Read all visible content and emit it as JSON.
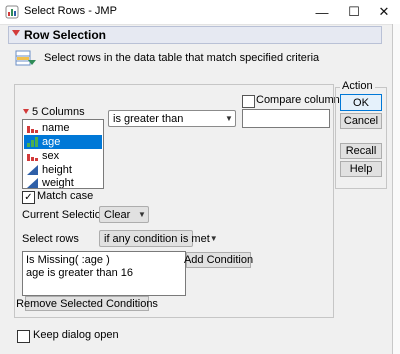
{
  "window": {
    "title": "Select Rows - JMP",
    "minimize_glyph": "—",
    "maximize_glyph": "☐",
    "close_glyph": "✕",
    "app_icon": "jmp-app-icon"
  },
  "outline": {
    "title": "Row Selection",
    "description": "Select rows in the data table that match specified criteria",
    "description_icon": "select-rows-icon",
    "disclosure_color": "#d23a3a"
  },
  "columns": {
    "header": "5 Columns",
    "items": [
      {
        "label": "name",
        "icon": "nominal-bars-icon",
        "selected": false
      },
      {
        "label": "age",
        "icon": "ordinal-bars-icon",
        "selected": true
      },
      {
        "label": "sex",
        "icon": "nominal-bars-icon",
        "selected": false
      },
      {
        "label": "height",
        "icon": "continuous-triangle-icon",
        "selected": false
      },
      {
        "label": "weight",
        "icon": "continuous-triangle-icon",
        "selected": false
      }
    ]
  },
  "condition": {
    "operator": "is greater than",
    "compare_label": "Compare column",
    "compare_checked": false,
    "value": ""
  },
  "match_case": {
    "label": "Match case",
    "checked": true,
    "check_glyph": "✓"
  },
  "current_selection": {
    "label": "Current Selection",
    "value": "Clear"
  },
  "select_rows": {
    "label": "Select rows",
    "value": "if any condition is met"
  },
  "conditions": [
    "Is Missing( :age )",
    "age is greater than 16"
  ],
  "buttons": {
    "add_condition": "Add Condition",
    "remove_selected": "Remove Selected Conditions"
  },
  "action": {
    "label": "Action",
    "ok": "OK",
    "cancel": "Cancel",
    "recall": "Recall",
    "help": "Help"
  },
  "keep_open": {
    "label": "Keep dialog open",
    "checked": false
  },
  "colors": {
    "selection": "#0078d7",
    "accent_red": "#d23a3a",
    "continuous_blue": "#2e5fa8"
  }
}
